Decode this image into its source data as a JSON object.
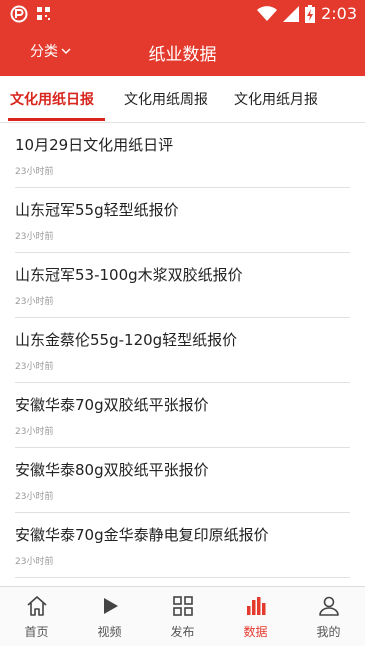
{
  "status_bar": {
    "time": "2:03"
  },
  "app_bar": {
    "category_label": "分类",
    "title": "纸业数据"
  },
  "tabs": [
    {
      "label": "文化用纸日报"
    },
    {
      "label": "文化用纸周报"
    },
    {
      "label": "文化用纸月报"
    }
  ],
  "articles": [
    {
      "title": "10月29日文化用纸日评",
      "time": "23小时前"
    },
    {
      "title": "山东冠军55g轻型纸报价",
      "time": "23小时前"
    },
    {
      "title": "山东冠军53-100g木浆双胶纸报价",
      "time": "23小时前"
    },
    {
      "title": "山东金蔡伦55g-120g轻型纸报价",
      "time": "23小时前"
    },
    {
      "title": "安徽华泰70g双胶纸平张报价",
      "time": "23小时前"
    },
    {
      "title": "安徽华泰80g双胶纸平张报价",
      "time": "23小时前"
    },
    {
      "title": "安徽华泰70g金华泰静电复印原纸报价",
      "time": "23小时前"
    }
  ],
  "bottom_nav": [
    {
      "label": "首页",
      "icon": "home-icon"
    },
    {
      "label": "视频",
      "icon": "play-icon"
    },
    {
      "label": "发布",
      "icon": "grid-icon"
    },
    {
      "label": "数据",
      "icon": "bar-chart-icon"
    },
    {
      "label": "我的",
      "icon": "user-icon"
    }
  ],
  "colors": {
    "brand": "#e43a2e",
    "active_tab": "#d8251d"
  }
}
